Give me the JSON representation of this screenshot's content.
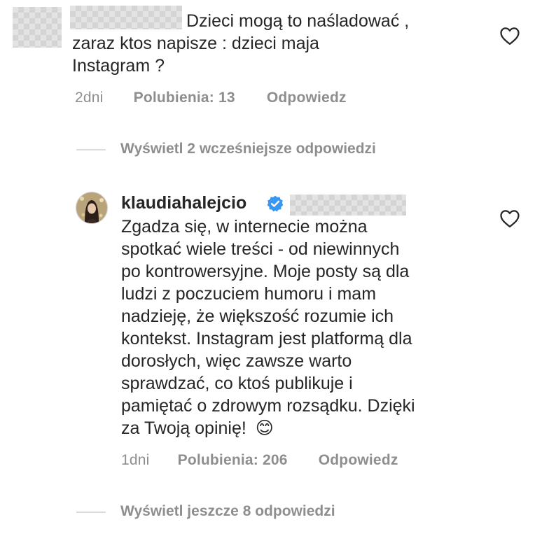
{
  "comment1": {
    "text_line1": "Dzieci mogą to naśladować ,",
    "text_line2": "zaraz ktos napisze : dzieci maja",
    "text_line3": "Instagram ?",
    "time": "2dni",
    "likes": "Polubienia: 13",
    "reply": "Odpowiedz"
  },
  "view_earlier": "Wyświetl 2 wcześniejsze odpowiedzi",
  "reply1": {
    "username": "klaudiahalejcio",
    "text_lines": [
      "Zgadza się, w internecie można",
      "spotkać wiele treści - od niewinnych",
      "po kontrowersyjne. Moje posty są dla",
      "ludzi z poczuciem humoru i mam",
      "nadzieję, że większość rozumie ich",
      "kontekst. Instagram jest platformą dla",
      "dorosłych, więc zawsze warto",
      "sprawdzać, co ktoś publikuje i",
      "pamiętać o zdrowym rozsądku. Dzięki",
      "za Twoją opinię!"
    ],
    "emoji": "😊",
    "time": "1dni",
    "likes": "Polubienia: 206",
    "reply": "Odpowiedz"
  },
  "view_more": "Wyświetl jeszcze 8 odpowiedzi",
  "colors": {
    "text": "#262626",
    "secondary": "#8e8e8e",
    "verified": "#3897f0",
    "divider": "#dbdbdb"
  },
  "icons": {
    "like": "heart-outline-icon",
    "verified": "verified-badge-icon"
  }
}
